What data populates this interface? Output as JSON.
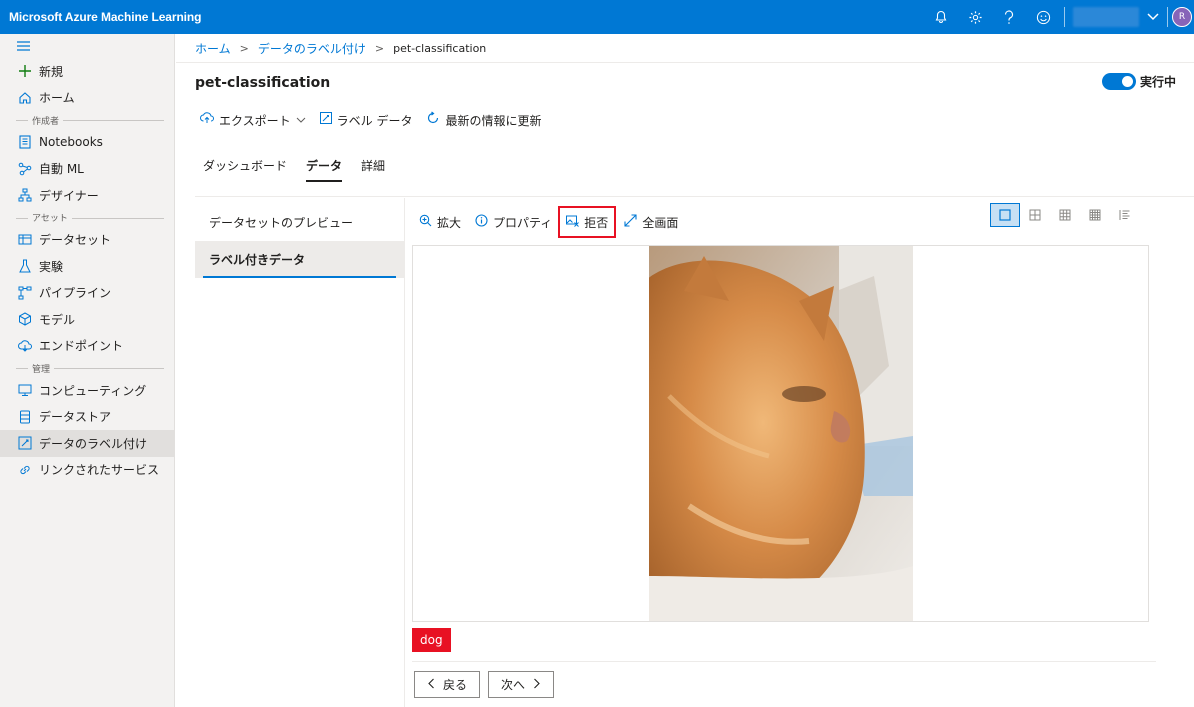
{
  "app": {
    "title": "Microsoft Azure Machine Learning",
    "avatar_initial": "R"
  },
  "sidebar": {
    "items_top": [
      {
        "label": "新規",
        "icon": "plus-icon"
      },
      {
        "label": "ホーム",
        "icon": "home-icon"
      }
    ],
    "sections": [
      {
        "label": "作成者",
        "items": [
          {
            "label": "Notebooks",
            "icon": "notebook-icon"
          },
          {
            "label": "自動 ML",
            "icon": "automl-icon"
          },
          {
            "label": "デザイナー",
            "icon": "designer-icon"
          }
        ]
      },
      {
        "label": "アセット",
        "items": [
          {
            "label": "データセット",
            "icon": "dataset-icon"
          },
          {
            "label": "実験",
            "icon": "experiment-icon"
          },
          {
            "label": "パイプライン",
            "icon": "pipeline-icon"
          },
          {
            "label": "モデル",
            "icon": "model-icon"
          },
          {
            "label": "エンドポイント",
            "icon": "endpoint-icon"
          }
        ]
      },
      {
        "label": "管理",
        "items": [
          {
            "label": "コンピューティング",
            "icon": "compute-icon"
          },
          {
            "label": "データストア",
            "icon": "datastore-icon"
          },
          {
            "label": "データのラベル付け",
            "icon": "labeling-icon",
            "active": true
          },
          {
            "label": "リンクされたサービス",
            "icon": "linked-services-icon"
          }
        ]
      }
    ]
  },
  "breadcrumb": {
    "home": "ホーム",
    "labeling": "データのラベル付け",
    "current": "pet-classification"
  },
  "page": {
    "title": "pet-classification",
    "status_label": "実行中"
  },
  "commands": {
    "export": "エクスポート",
    "label_data": "ラベル データ",
    "refresh": "最新の情報に更新"
  },
  "tabs": [
    {
      "label": "ダッシュボード"
    },
    {
      "label": "データ",
      "active": true
    },
    {
      "label": "詳細"
    }
  ],
  "subnav": {
    "preview": "データセットのプレビュー",
    "labeled": "ラベル付きデータ"
  },
  "image_toolbar": {
    "zoom": "拡大",
    "properties": "プロパティ",
    "reject": "拒否",
    "fullscreen": "全画面"
  },
  "image": {
    "label_tag": "dog"
  },
  "pager": {
    "back": "戻る",
    "next": "次へ"
  },
  "colors": {
    "accent": "#0078d4",
    "tag": "#e81123",
    "highlight": "#e81123"
  }
}
